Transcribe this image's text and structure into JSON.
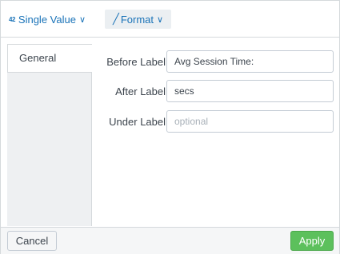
{
  "toolbar": {
    "viz_icon": "42",
    "viz_label": "Single Value",
    "format_label": "Format",
    "chevron": "∨",
    "brush": "╱"
  },
  "sidebar": {
    "tabs": [
      {
        "label": "General",
        "selected": true
      }
    ]
  },
  "form": {
    "before_label": {
      "label": "Before Label",
      "value": "Avg Session Time:"
    },
    "after_label": {
      "label": "After Label",
      "value": "secs"
    },
    "under_label": {
      "label": "Under Label",
      "value": "",
      "placeholder": "optional"
    }
  },
  "footer": {
    "cancel_label": "Cancel",
    "apply_label": "Apply"
  },
  "colors": {
    "accent": "#1a73b8",
    "apply": "#5cc05c",
    "sidebar_bg": "#eef0f2"
  }
}
